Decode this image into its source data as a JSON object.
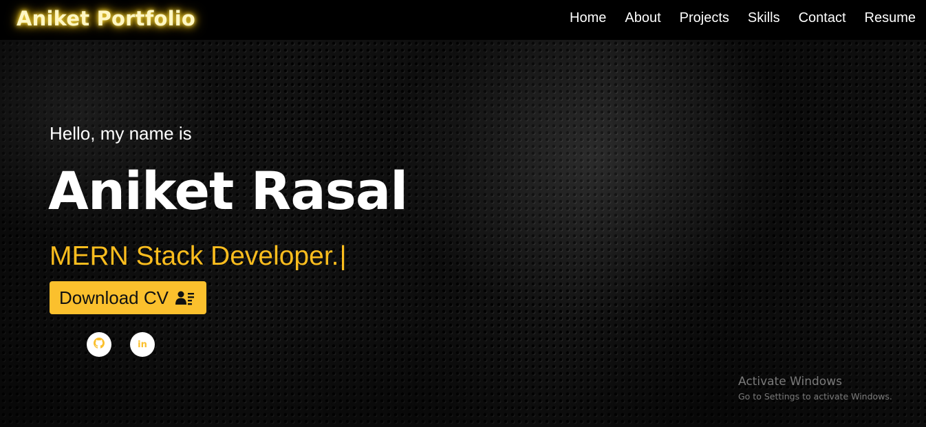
{
  "brand": {
    "title": "Aniket Portfolio",
    "glow_color": "#ffe14d"
  },
  "nav": {
    "items": [
      {
        "label": "Home"
      },
      {
        "label": "About"
      },
      {
        "label": "Projects"
      },
      {
        "label": "Skills"
      },
      {
        "label": "Contact"
      },
      {
        "label": "Resume"
      }
    ]
  },
  "hero": {
    "greeting": "Hello, my name is",
    "name": "Aniket Rasal",
    "role": "MERN Stack Developer.",
    "cursor": "|",
    "accent_color": "#fbbd1e",
    "download_button": {
      "label": "Download CV",
      "icon": "id-card-icon"
    },
    "social": [
      {
        "icon": "github-icon"
      },
      {
        "icon": "linkedin-icon",
        "glyph": "in"
      }
    ]
  },
  "watermark": {
    "title": "Activate Windows",
    "subtitle": "Go to Settings to activate Windows."
  }
}
